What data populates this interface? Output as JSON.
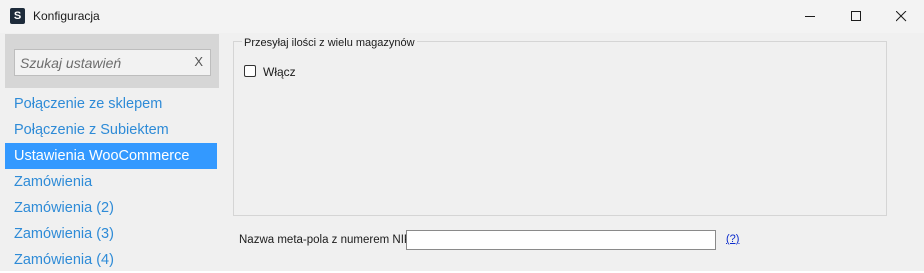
{
  "window": {
    "title": "Konfiguracja",
    "app_icon_letter": "S"
  },
  "sidebar": {
    "search": {
      "placeholder": "Szukaj ustawień",
      "value": "",
      "clear_label": "X"
    },
    "items": [
      {
        "label": "Połączenie ze sklepem",
        "active": false
      },
      {
        "label": "Połączenie z Subiektem",
        "active": false
      },
      {
        "label": "Ustawienia WooCommerce",
        "active": true
      },
      {
        "label": "Zamówienia",
        "active": false
      },
      {
        "label": "Zamówienia (2)",
        "active": false
      },
      {
        "label": "Zamówienia (3)",
        "active": false
      },
      {
        "label": "Zamówienia (4)",
        "active": false
      }
    ]
  },
  "main": {
    "group": {
      "legend": "Przesyłaj ilości z wielu magazynów",
      "enable_checkbox": {
        "label": "Włącz",
        "checked": false
      }
    },
    "nip_field": {
      "label": "Nazwa meta-pola z numerem NIP",
      "value": "",
      "help_link": "(?)"
    }
  },
  "colors": {
    "accent": "#3399ff",
    "link": "#2e8bd7",
    "sidebar_bg": "#f0f0f0",
    "titlebar_bg": "#f3f3f3"
  }
}
